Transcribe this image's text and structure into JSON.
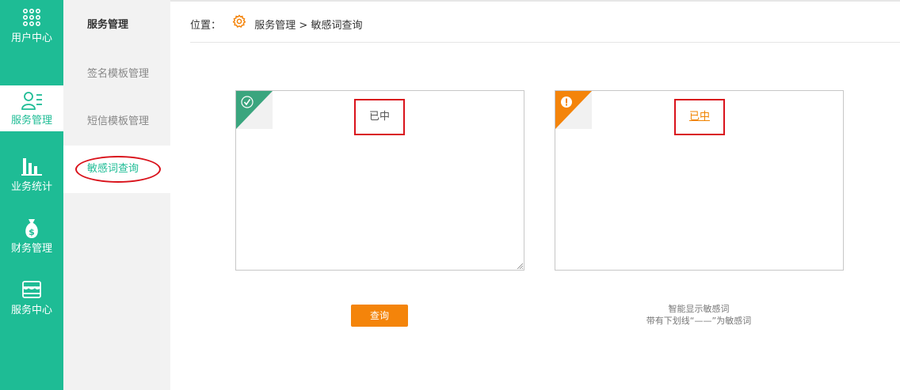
{
  "nav": [
    {
      "label": "用户中心",
      "icon": "dots-grid-icon"
    },
    {
      "label": "服务管理",
      "icon": "user-list-icon"
    },
    {
      "label": "业务统计",
      "icon": "bar-chart-icon"
    },
    {
      "label": "财务管理",
      "icon": "money-bag-icon"
    },
    {
      "label": "服务中心",
      "icon": "store-icon"
    }
  ],
  "submenu": {
    "title": "服务管理",
    "items": [
      "签名模板管理",
      "短信模板管理",
      "敏感词查询"
    ]
  },
  "breadcrumb": {
    "prefix": "位置：",
    "path": "服务管理 > 敏感词查询"
  },
  "input_panel": {
    "text": "已中",
    "corner_icon": "check-icon"
  },
  "result_panel": {
    "text": "已中",
    "corner_icon": "warning-icon"
  },
  "query_button": "查询",
  "hint": {
    "line1": "智能显示敏感词",
    "line2": "带有下划线“——”为敏感词"
  },
  "colors": {
    "accent": "#1ebc95",
    "orange": "#f4840a",
    "highlight_red": "#d9121b",
    "corner_green": "#3aa57e"
  }
}
